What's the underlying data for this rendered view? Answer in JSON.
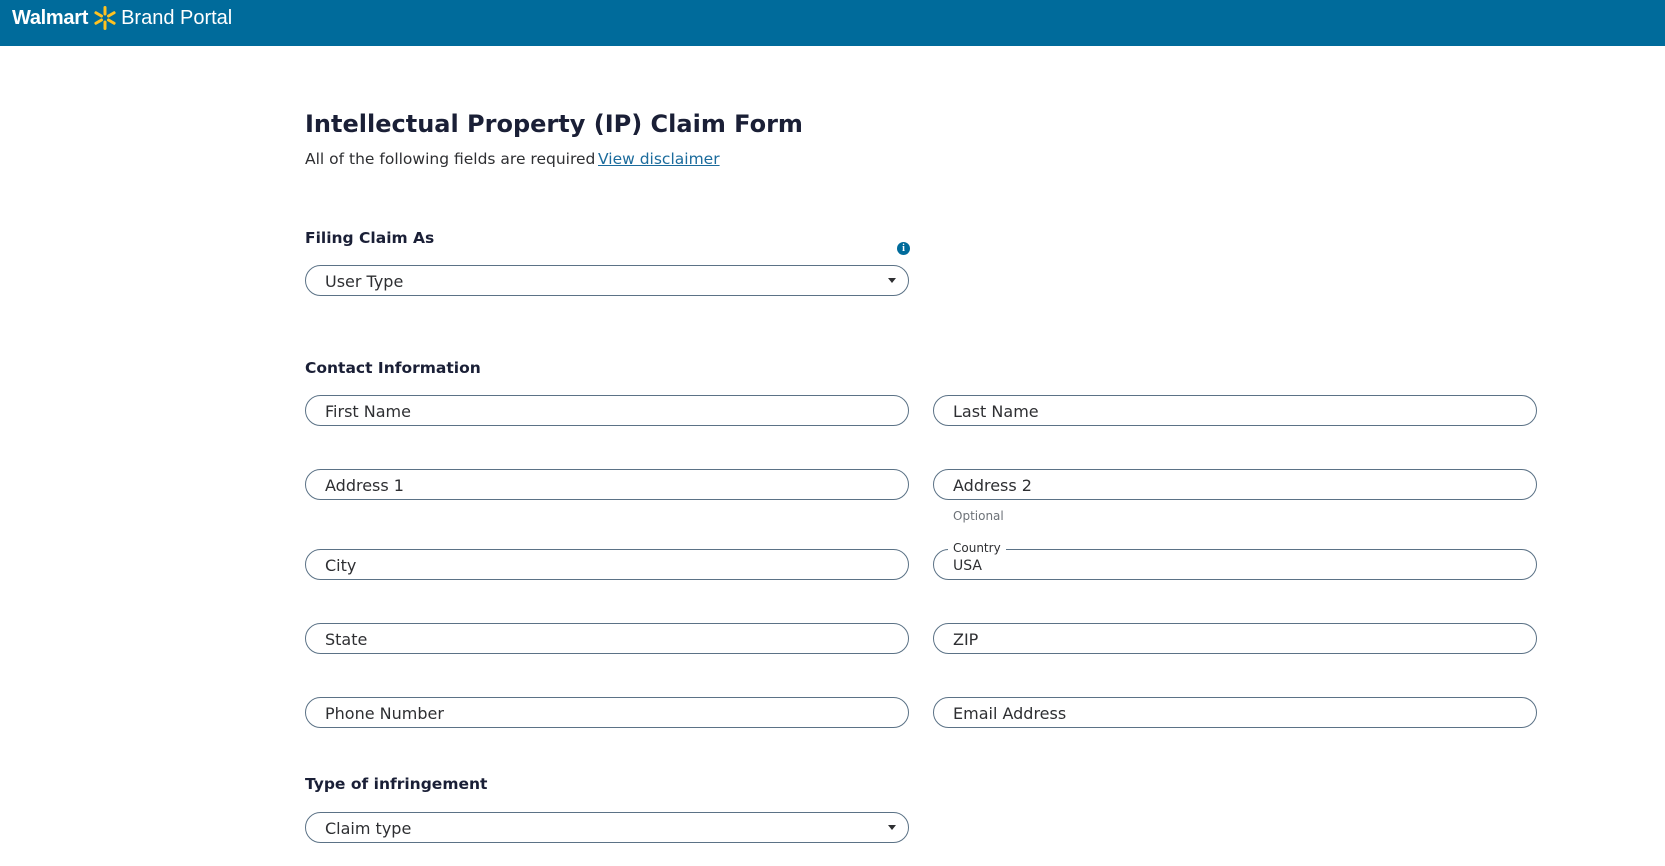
{
  "header": {
    "brand": "Walmart",
    "brand_sub": "Brand Portal",
    "colors": {
      "bar": "#006b9b",
      "spark": "#ffc220"
    }
  },
  "page": {
    "title": "Intellectual Property (IP) Claim Form",
    "subtitle": "All of the following fields are required",
    "disclaimer_link": "View disclaimer"
  },
  "filing": {
    "heading": "Filing Claim As",
    "info_icon": "info-icon",
    "user_type_placeholder": "User Type"
  },
  "contact": {
    "heading": "Contact Information",
    "first_name": "First Name",
    "last_name": "Last Name",
    "address1": "Address 1",
    "address2": "Address 2",
    "address2_helper": "Optional",
    "city": "City",
    "country_label": "Country",
    "country_value": "USA",
    "state": "State",
    "zip": "ZIP",
    "phone": "Phone Number",
    "email": "Email Address"
  },
  "infringement": {
    "heading": "Type of infringement",
    "claim_type_placeholder": "Claim type"
  }
}
